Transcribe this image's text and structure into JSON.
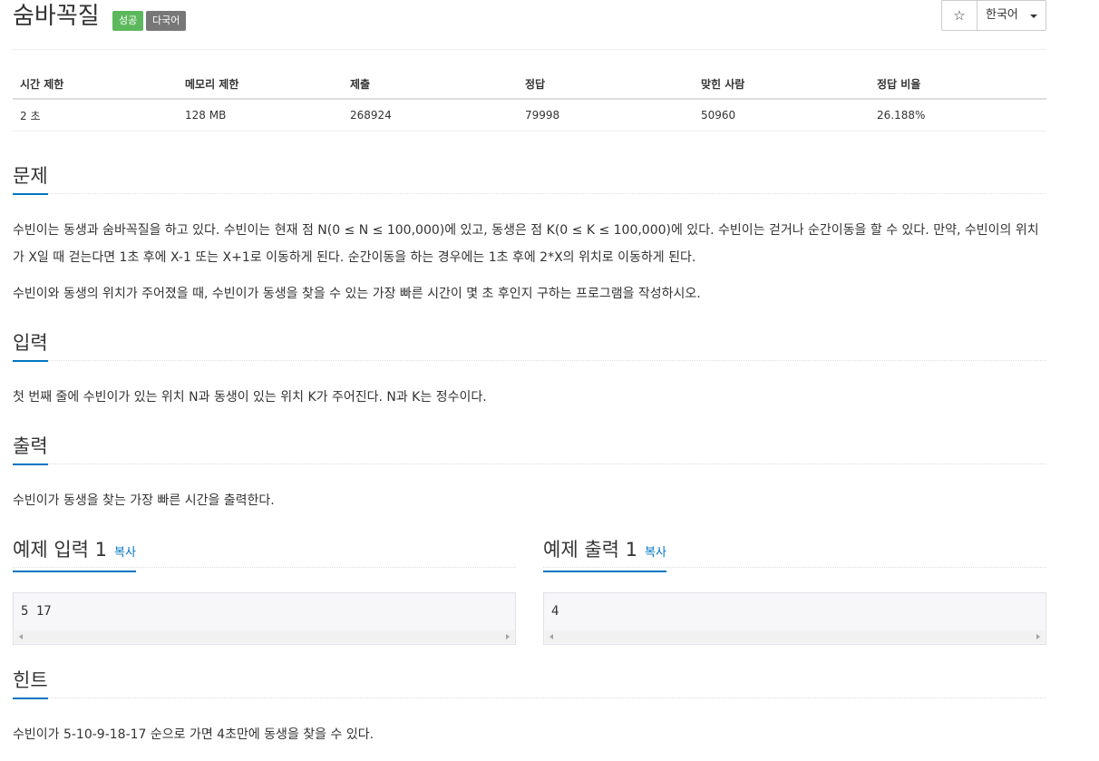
{
  "problem": {
    "title": "숨바꼭질",
    "badges": {
      "status": "성공",
      "language": "다국어"
    },
    "actions": {
      "star": "☆",
      "language_select": "한국어"
    }
  },
  "info_table": {
    "headers": [
      "시간 제한",
      "메모리 제한",
      "제출",
      "정답",
      "맞힌 사람",
      "정답 비율"
    ],
    "values": [
      "2 초",
      "128 MB",
      "268924",
      "79998",
      "50960",
      "26.188%"
    ]
  },
  "sections": {
    "description": {
      "title": "문제",
      "paragraphs": [
        "수빈이는 동생과 숨바꼭질을 하고 있다. 수빈이는 현재 점 N(0 ≤ N ≤ 100,000)에 있고, 동생은 점 K(0 ≤ K ≤ 100,000)에 있다. 수빈이는 걷거나 순간이동을 할 수 있다. 만약, 수빈이의 위치가 X일 때 걷는다면 1초 후에 X-1 또는 X+1로 이동하게 된다. 순간이동을 하는 경우에는 1초 후에 2*X의 위치로 이동하게 된다.",
        "수빈이와 동생의 위치가 주어졌을 때, 수빈이가 동생을 찾을 수 있는 가장 빠른 시간이 몇 초 후인지 구하는 프로그램을 작성하시오."
      ]
    },
    "input": {
      "title": "입력",
      "text": "첫 번째 줄에 수빈이가 있는 위치 N과 동생이 있는 위치 K가 주어진다. N과 K는 정수이다."
    },
    "output": {
      "title": "출력",
      "text": "수빈이가 동생을 찾는 가장 빠른 시간을 출력한다."
    },
    "sample_input": {
      "title": "예제 입력 1",
      "copy": "복사",
      "content": "5 17"
    },
    "sample_output": {
      "title": "예제 출력 1",
      "copy": "복사",
      "content": "4"
    },
    "hint": {
      "title": "힌트",
      "text": "수빈이가 5-10-9-18-17 순으로 가면 4초만에 동생을 찾을 수 있다."
    }
  },
  "colors": {
    "accent": "#0076c0",
    "badge_success": "#5cb85c",
    "badge_lang": "#777777"
  }
}
